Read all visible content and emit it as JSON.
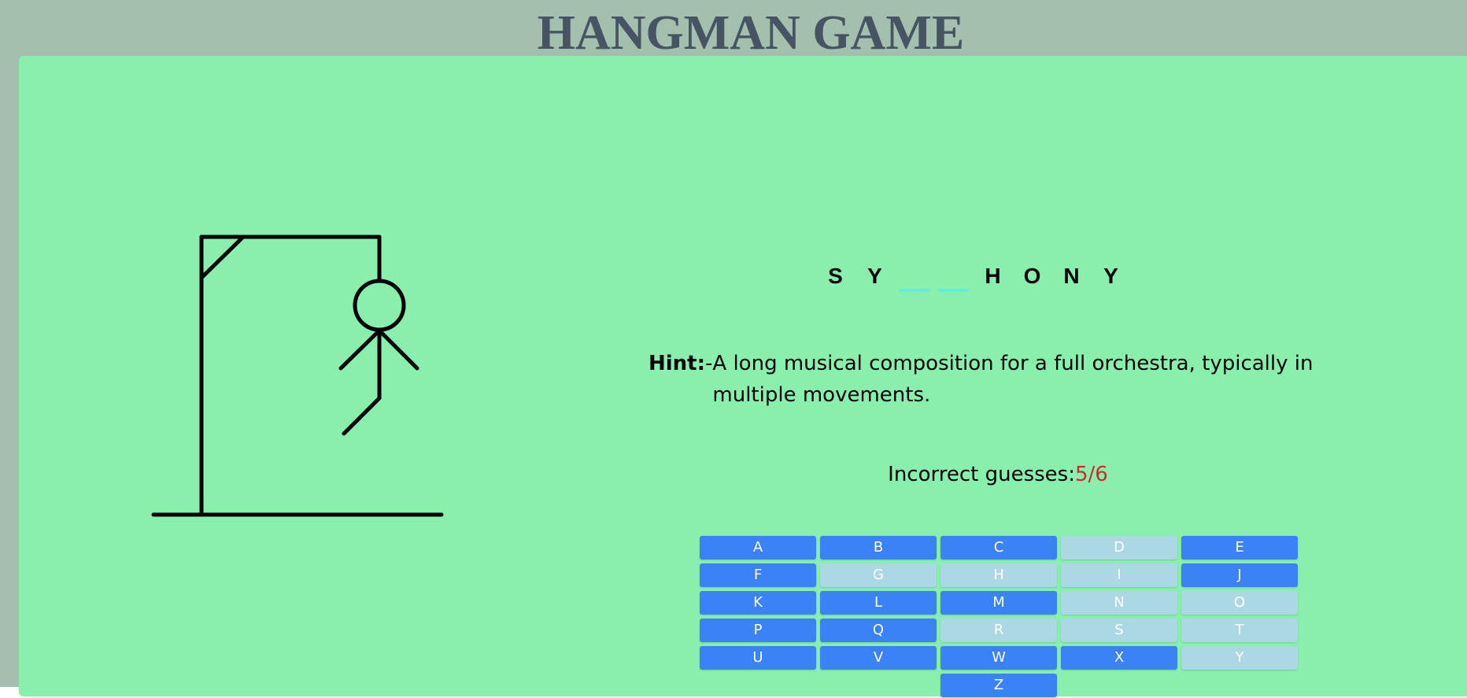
{
  "title": "HANGMAN GAME",
  "colors": {
    "page_bg": "#a2c0ad",
    "card_bg": "#88f0ac",
    "title": "#475463",
    "key_active": "#3b82f6",
    "key_used": "#acd8e6",
    "blank_underline": "#66ebe0",
    "incorrect_count": "#d6262b"
  },
  "hangman": {
    "stage": 5,
    "max_stage": 6,
    "parts_shown": [
      "head",
      "body",
      "left-arm",
      "right-arm",
      "left-leg"
    ]
  },
  "word": {
    "letters": [
      "S",
      "Y",
      "",
      "",
      "H",
      "O",
      "N",
      "Y"
    ]
  },
  "hint": {
    "label": "Hint:",
    "dash": "-",
    "text": "A long musical composition for a full orchestra, typically in multiple movements."
  },
  "guesses": {
    "label": "Incorrect guesses:",
    "count": "5/6"
  },
  "keyboard": {
    "keys": [
      {
        "letter": "A",
        "used": false
      },
      {
        "letter": "B",
        "used": false
      },
      {
        "letter": "C",
        "used": false
      },
      {
        "letter": "D",
        "used": true
      },
      {
        "letter": "E",
        "used": false
      },
      {
        "letter": "F",
        "used": false
      },
      {
        "letter": "G",
        "used": true
      },
      {
        "letter": "H",
        "used": true
      },
      {
        "letter": "I",
        "used": true
      },
      {
        "letter": "J",
        "used": false
      },
      {
        "letter": "K",
        "used": false
      },
      {
        "letter": "L",
        "used": false
      },
      {
        "letter": "M",
        "used": false
      },
      {
        "letter": "N",
        "used": true
      },
      {
        "letter": "O",
        "used": true
      },
      {
        "letter": "P",
        "used": false
      },
      {
        "letter": "Q",
        "used": false
      },
      {
        "letter": "R",
        "used": true
      },
      {
        "letter": "S",
        "used": true
      },
      {
        "letter": "T",
        "used": true
      },
      {
        "letter": "U",
        "used": false
      },
      {
        "letter": "V",
        "used": false
      },
      {
        "letter": "W",
        "used": false
      },
      {
        "letter": "X",
        "used": false
      },
      {
        "letter": "Y",
        "used": true
      },
      {
        "letter": "Z",
        "used": false
      }
    ]
  }
}
